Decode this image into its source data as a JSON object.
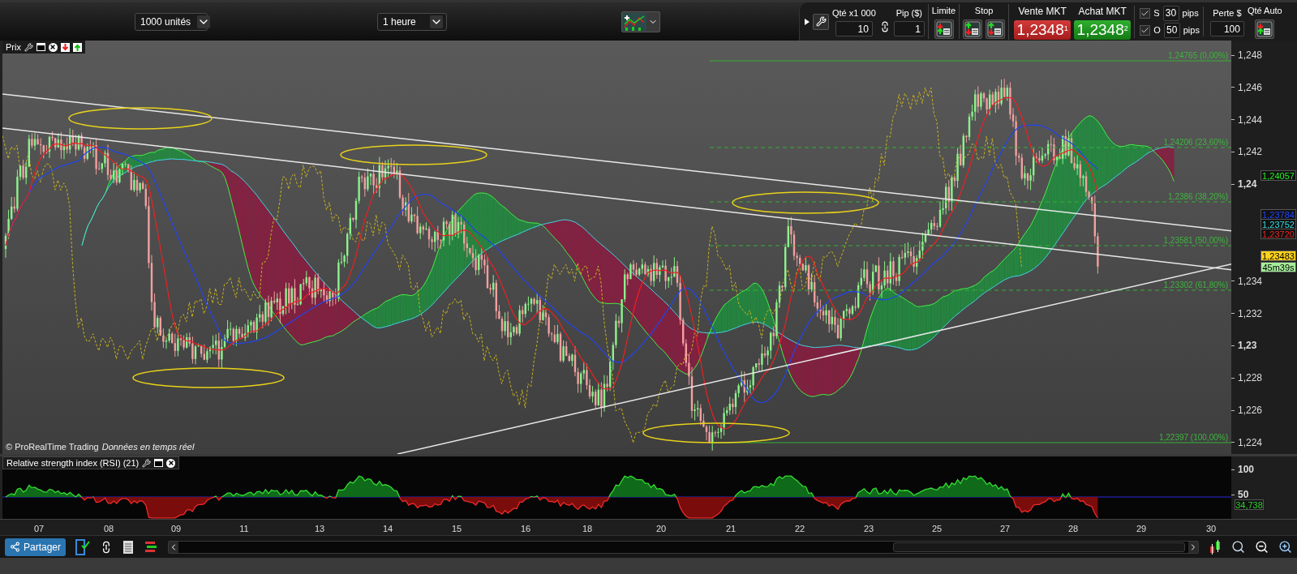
{
  "toolbar": {
    "quantity_dropdown": "1000 unités",
    "timeframe_dropdown": "1 heure"
  },
  "order_panel": {
    "qty_label": "Qté x1 000",
    "qty_value": "10",
    "pip_label": "Pip ($)",
    "pip_value": "1",
    "limit_label": "Limite",
    "stop_label": "Stop",
    "sell": {
      "label": "Vente MKT",
      "price": "1,2348",
      "digit": "1"
    },
    "buy": {
      "label": "Achat MKT",
      "price": "1,2348",
      "digit": "2"
    },
    "stops": [
      {
        "letter": "S",
        "checked": true,
        "value": "30",
        "unit": "pips"
      },
      {
        "letter": "O",
        "checked": true,
        "value": "50",
        "unit": "pips"
      }
    ],
    "loss_label": "Perte $",
    "loss_value": "100",
    "auto_qty_label": "Qté Auto"
  },
  "price_pane": {
    "title": "Prix",
    "copyright": "© ProRealTime Trading",
    "realtime_note": "Données en temps réel",
    "fib_levels": [
      {
        "label": "1,24765 (0,00%)",
        "kind": "solid"
      },
      {
        "label": "1,24206 (23,60%)",
        "kind": "dashed"
      },
      {
        "label": "1,2386 (38,20%)",
        "kind": "dashed"
      },
      {
        "label": "1,23581 (50,00%)",
        "kind": "dashed"
      },
      {
        "label": "1,23302 (61,80%)",
        "kind": "dashed"
      },
      {
        "label": "1,22397 (100,00%)",
        "kind": "solid"
      }
    ],
    "y_ticks": [
      {
        "label": "1,248",
        "kind": "minor"
      },
      {
        "label": "1,246",
        "kind": "minor"
      },
      {
        "label": "1,244",
        "kind": "minor"
      },
      {
        "label": "1,242",
        "kind": "minor"
      },
      {
        "label": "1,24",
        "kind": "major"
      },
      {
        "label": "1,234",
        "kind": "minor"
      },
      {
        "label": "1,232",
        "kind": "minor"
      },
      {
        "label": "1,23",
        "kind": "major"
      },
      {
        "label": "1,228",
        "kind": "minor"
      },
      {
        "label": "1,226",
        "kind": "minor"
      },
      {
        "label": "1,224",
        "kind": "minor"
      }
    ],
    "badges": [
      {
        "label": "1,24057",
        "color": "#22ee22",
        "kind": "text"
      },
      {
        "label": "1,23784",
        "color": "#2244ff",
        "kind": "text"
      },
      {
        "label": "1,23752",
        "color": "#33dddd",
        "kind": "text"
      },
      {
        "label": "1,23720",
        "color": "#ee2222",
        "kind": "text"
      },
      {
        "label": "1,23483",
        "color": "#ffd21a",
        "kind": "fill"
      },
      {
        "label": "45m39s",
        "color": "#a6ee9a",
        "kind": "fill"
      }
    ]
  },
  "rsi_pane": {
    "title": "Relative strength index (RSI) (21)",
    "y_ticks": [
      "100",
      "50"
    ],
    "badge": "34,738"
  },
  "x_axis": [
    "07",
    "08",
    "09",
    "11",
    "13",
    "14",
    "15",
    "16",
    "18",
    "20",
    "21",
    "22",
    "23",
    "25",
    "27",
    "28",
    "29",
    "30"
  ],
  "bottom_bar": {
    "share_button": "Partager"
  }
}
